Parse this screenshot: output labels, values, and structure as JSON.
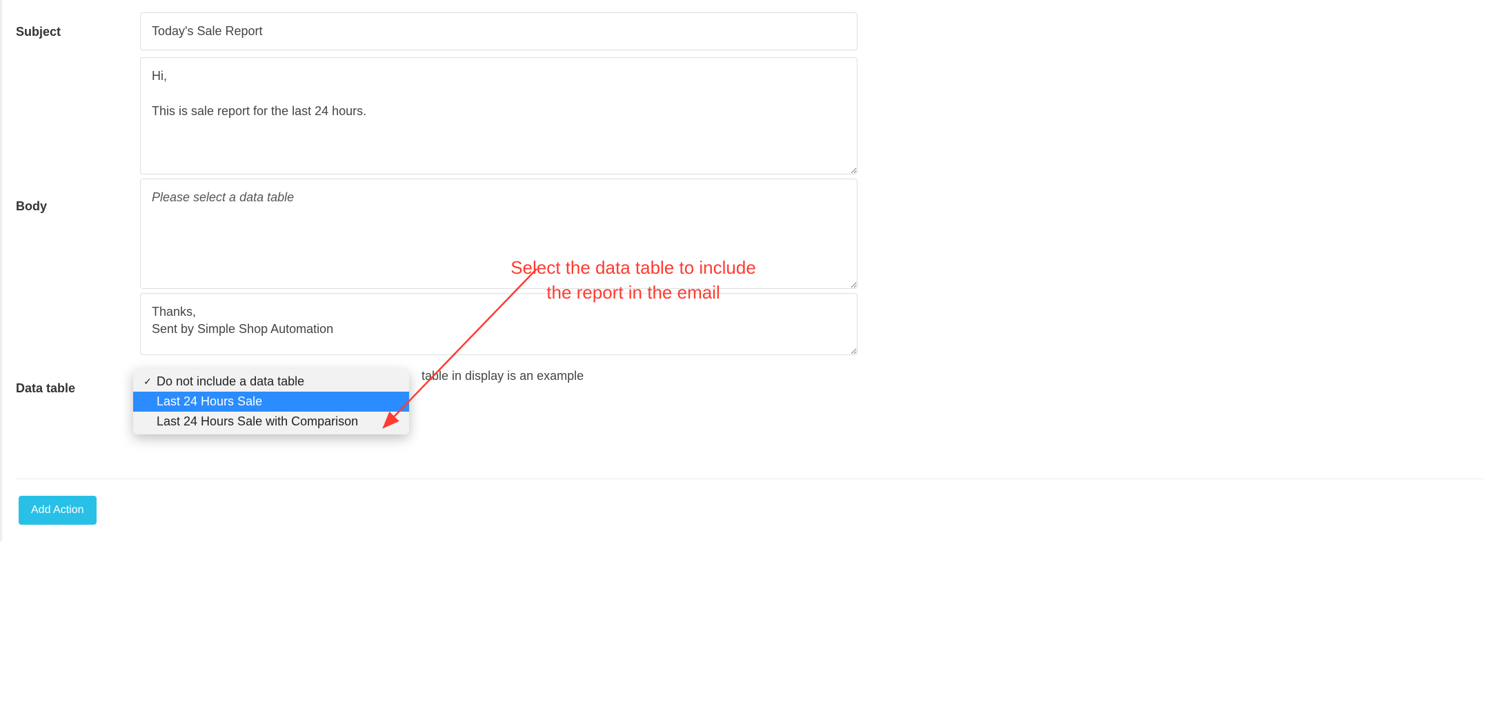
{
  "subject": {
    "label": "Subject",
    "value": "Today's Sale Report"
  },
  "body": {
    "label": "Body",
    "top_value": "Hi,\n\nThis is sale report for the last 24 hours.",
    "placeholder_value": "Please select a data table",
    "bottom_value": "Thanks,\nSent by Simple Shop Automation"
  },
  "data_table": {
    "label": "Data table",
    "hint": "table in display is an example",
    "options": [
      {
        "label": "Do not include a data table",
        "checked": true,
        "highlight": false
      },
      {
        "label": "Last 24 Hours Sale",
        "checked": false,
        "highlight": true
      },
      {
        "label": "Last 24 Hours Sale with Comparison",
        "checked": false,
        "highlight": false
      }
    ]
  },
  "annotation": {
    "line1": "Select the data table to include",
    "line2": "the report in the email"
  },
  "buttons": {
    "add_action": "Add Action"
  }
}
